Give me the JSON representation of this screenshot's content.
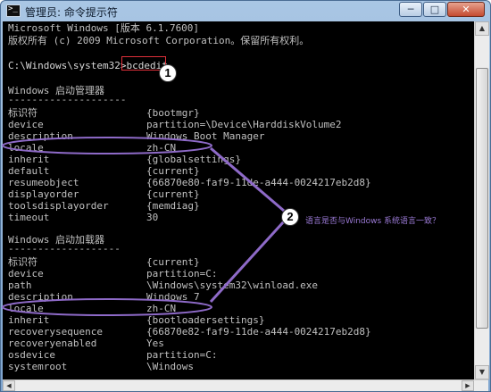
{
  "window": {
    "title": "管理员: 命令提示符",
    "controls": [
      "─",
      "□",
      "✕"
    ]
  },
  "console": {
    "header": [
      "Microsoft Windows [版本 6.1.7600]",
      "版权所有 (c) 2009 Microsoft Corporation。保留所有权利。"
    ],
    "prompt": "C:\\Windows\\system32>",
    "command": "bcdedit",
    "section1": {
      "title": "Windows 启动管理器",
      "underline": "--------------------",
      "header": {
        "key": "标识符",
        "value": "{bootmgr}"
      },
      "entries": [
        {
          "key": "device",
          "value": "partition=\\Device\\HarddiskVolume2"
        },
        {
          "key": "description",
          "value": "Windows Boot Manager"
        },
        {
          "key": "locale",
          "value": "zh-CN"
        },
        {
          "key": "inherit",
          "value": "{globalsettings}"
        },
        {
          "key": "default",
          "value": "{current}"
        },
        {
          "key": "resumeobject",
          "value": "{66870e80-faf9-11de-a444-0024217eb2d8}"
        },
        {
          "key": "displayorder",
          "value": "{current}"
        },
        {
          "key": "toolsdisplayorder",
          "value": "{memdiag}"
        },
        {
          "key": "timeout",
          "value": "30"
        }
      ]
    },
    "section2": {
      "title": "Windows 启动加载器",
      "underline": "-------------------",
      "header": {
        "key": "标识符",
        "value": "{current}"
      },
      "entries": [
        {
          "key": "device",
          "value": "partition=C:"
        },
        {
          "key": "path",
          "value": "\\Windows\\system32\\winload.exe"
        },
        {
          "key": "description",
          "value": "Windows 7"
        },
        {
          "key": "locale",
          "value": "zh-CN"
        },
        {
          "key": "inherit",
          "value": "{bootloadersettings}"
        },
        {
          "key": "recoverysequence",
          "value": "{66870e82-faf9-11de-a444-0024217eb2d8}"
        },
        {
          "key": "recoveryenabled",
          "value": "Yes"
        },
        {
          "key": "osdevice",
          "value": "partition=C:"
        },
        {
          "key": "systemroot",
          "value": "\\Windows"
        }
      ]
    }
  },
  "annotations": {
    "badge1": "1",
    "badge2": "2",
    "note": "语言是否与Windows 系统语言一致？",
    "colors": {
      "command_box": "#e0303a",
      "locale_highlight": "#8e6ac8",
      "note_text": "#9b7ad6"
    }
  },
  "scrollbar": {
    "up_arrow": "▲",
    "down_arrow": "▼",
    "left_arrow": "◀",
    "right_arrow": "▶"
  }
}
